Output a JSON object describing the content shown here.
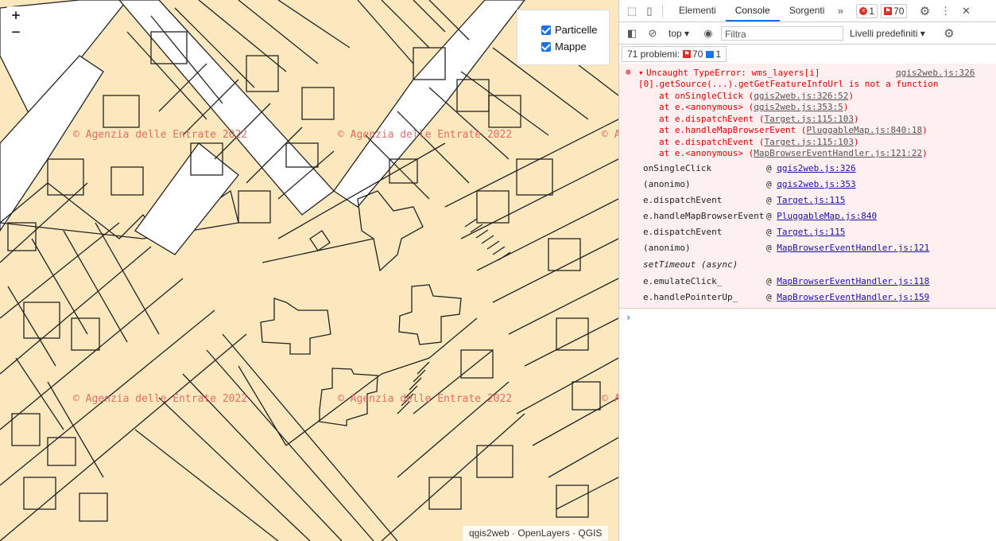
{
  "map": {
    "zoom_in": "+",
    "zoom_out": "−",
    "layers": [
      {
        "label": "Particelle",
        "checked": true
      },
      {
        "label": "Mappe",
        "checked": true
      }
    ],
    "watermark": "© Agenzia delle Entrate 2022",
    "attribution": "qgis2web · OpenLayers · QGIS"
  },
  "devtools": {
    "tabs": [
      "Elementi",
      "Console",
      "Sorgenti"
    ],
    "active_tab": "Console",
    "more": "»",
    "error_count": "1",
    "issue_count": "70",
    "context": "top",
    "filter_placeholder": "Filtra",
    "levels": "Livelli predefiniti",
    "problems_label": "71 problemi:",
    "problems_red": "70",
    "problems_blue": "1",
    "error": {
      "message_line1": "Uncaught TypeError: wms_layers[i]",
      "source": "qgis2web.js:326",
      "message_line2": "[0].getSource(...).getGetFeatureInfoUrl is not a function",
      "trace": [
        {
          "text": "at onSingleClick (",
          "link": "qgis2web.js:326:52",
          "end": ")"
        },
        {
          "text": "at e.<anonymous> (",
          "link": "qgis2web.js:353:5",
          "end": ")"
        },
        {
          "text": "at e.dispatchEvent (",
          "link": "Target.js:115:103",
          "end": ")"
        },
        {
          "text": "at e.handleMapBrowserEvent (",
          "link": "PluggableMap.js:840:18",
          "end": ")"
        },
        {
          "text": "at e.dispatchEvent (",
          "link": "Target.js:115:103",
          "end": ")"
        },
        {
          "text": "at e.<anonymous> (",
          "link": "MapBrowserEventHandler.js:121:22",
          "end": ")"
        }
      ],
      "stack": [
        {
          "fn": "onSingleClick",
          "link": "qgis2web.js:326"
        },
        {
          "fn": "(anonimo)",
          "link": "qgis2web.js:353"
        },
        {
          "fn": "e.dispatchEvent",
          "link": "Target.js:115"
        },
        {
          "fn": "e.handleMapBrowserEvent",
          "link": "PluggableMap.js:840"
        },
        {
          "fn": "e.dispatchEvent",
          "link": "Target.js:115"
        },
        {
          "fn": "(anonimo)",
          "link": "MapBrowserEventHandler.js:121"
        },
        {
          "fn": "setTimeout (async)",
          "link": ""
        },
        {
          "fn": "e.emulateClick_",
          "link": "MapBrowserEventHandler.js:118"
        },
        {
          "fn": "e.handlePointerUp_",
          "link": "MapBrowserEventHandler.js:159"
        }
      ]
    },
    "prompt": "›"
  }
}
